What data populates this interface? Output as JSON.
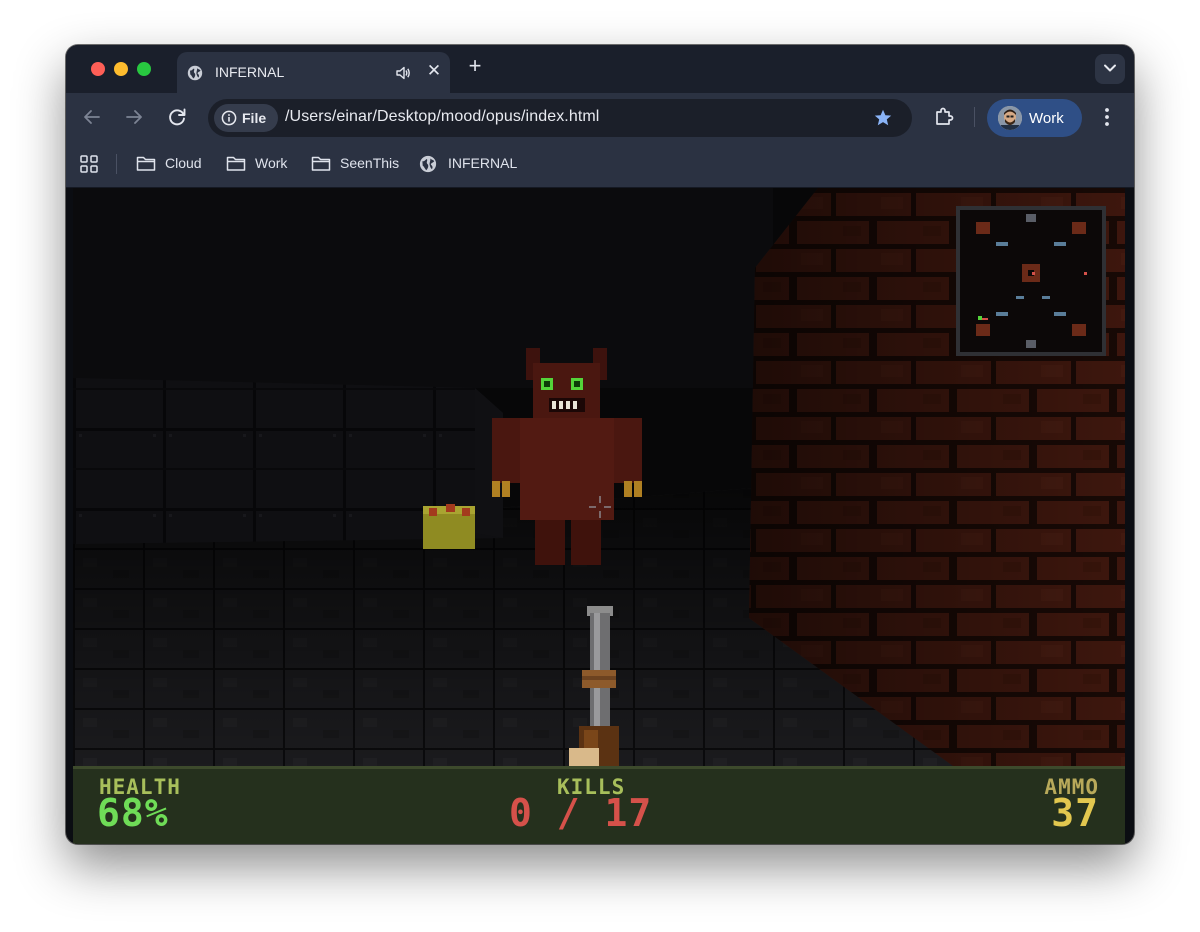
{
  "browser": {
    "tab": {
      "title": "INFERNAL",
      "favicon": "globe-icon",
      "audio_icon": "speaker-icon"
    },
    "omnibox": {
      "chip_label": "File",
      "url": "/Users/einar/Desktop/mood/opus/index.html"
    },
    "profile": {
      "label": "Work"
    },
    "bookmarks": [
      {
        "label": "Cloud",
        "icon": "folder-icon"
      },
      {
        "label": "Work",
        "icon": "folder-icon"
      },
      {
        "label": "SeenThis",
        "icon": "folder-icon"
      },
      {
        "label": "INFERNAL",
        "icon": "globe-icon"
      }
    ],
    "colors": {
      "tab_strip": "#1a1f2b",
      "toolbar": "#2b3242",
      "profile_pill": "#2f4f86",
      "star": "#8ab4f8"
    }
  },
  "game": {
    "hud": {
      "health_label": "HEALTH",
      "health_value": "68%",
      "kills_label": "KILLS",
      "kills_value": "0 / 17",
      "ammo_label": "AMMO",
      "ammo_value": "37"
    },
    "colors": {
      "health": "#6fdc57",
      "kills": "#d5514a",
      "ammo": "#e2c74f",
      "hud_bg": "#25301d",
      "demon": "#5a1b14",
      "brick": "#4a1d17"
    }
  }
}
